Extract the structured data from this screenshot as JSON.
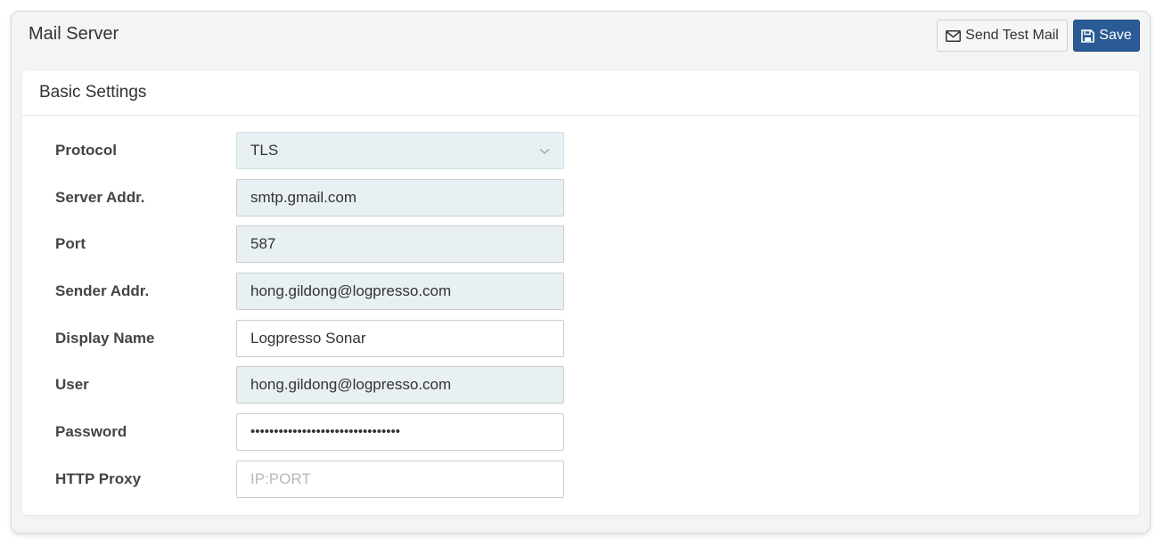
{
  "panel": {
    "title": "Mail Server",
    "send_test_label": "Send Test Mail",
    "save_label": "Save"
  },
  "card": {
    "title": "Basic Settings"
  },
  "fields": {
    "protocol": {
      "label": "Protocol",
      "value": "TLS"
    },
    "server_addr": {
      "label": "Server Addr.",
      "value": "smtp.gmail.com"
    },
    "port": {
      "label": "Port",
      "value": "587"
    },
    "sender_addr": {
      "label": "Sender Addr.",
      "value": "hong.gildong@logpresso.com"
    },
    "display_name": {
      "label": "Display Name",
      "value": "Logpresso Sonar"
    },
    "user": {
      "label": "User",
      "value": "hong.gildong@logpresso.com"
    },
    "password": {
      "label": "Password",
      "value": "••••••••••••••••••••••••••••••••"
    },
    "http_proxy": {
      "label": "HTTP Proxy",
      "value": "",
      "placeholder": "IP:PORT"
    }
  },
  "colors": {
    "primary": "#2a5b94",
    "filled_field": "#e8f0f3"
  },
  "icons": {
    "send_test": "envelope-icon",
    "save": "floppy-disk-icon",
    "select": "chevron-down-icon"
  }
}
